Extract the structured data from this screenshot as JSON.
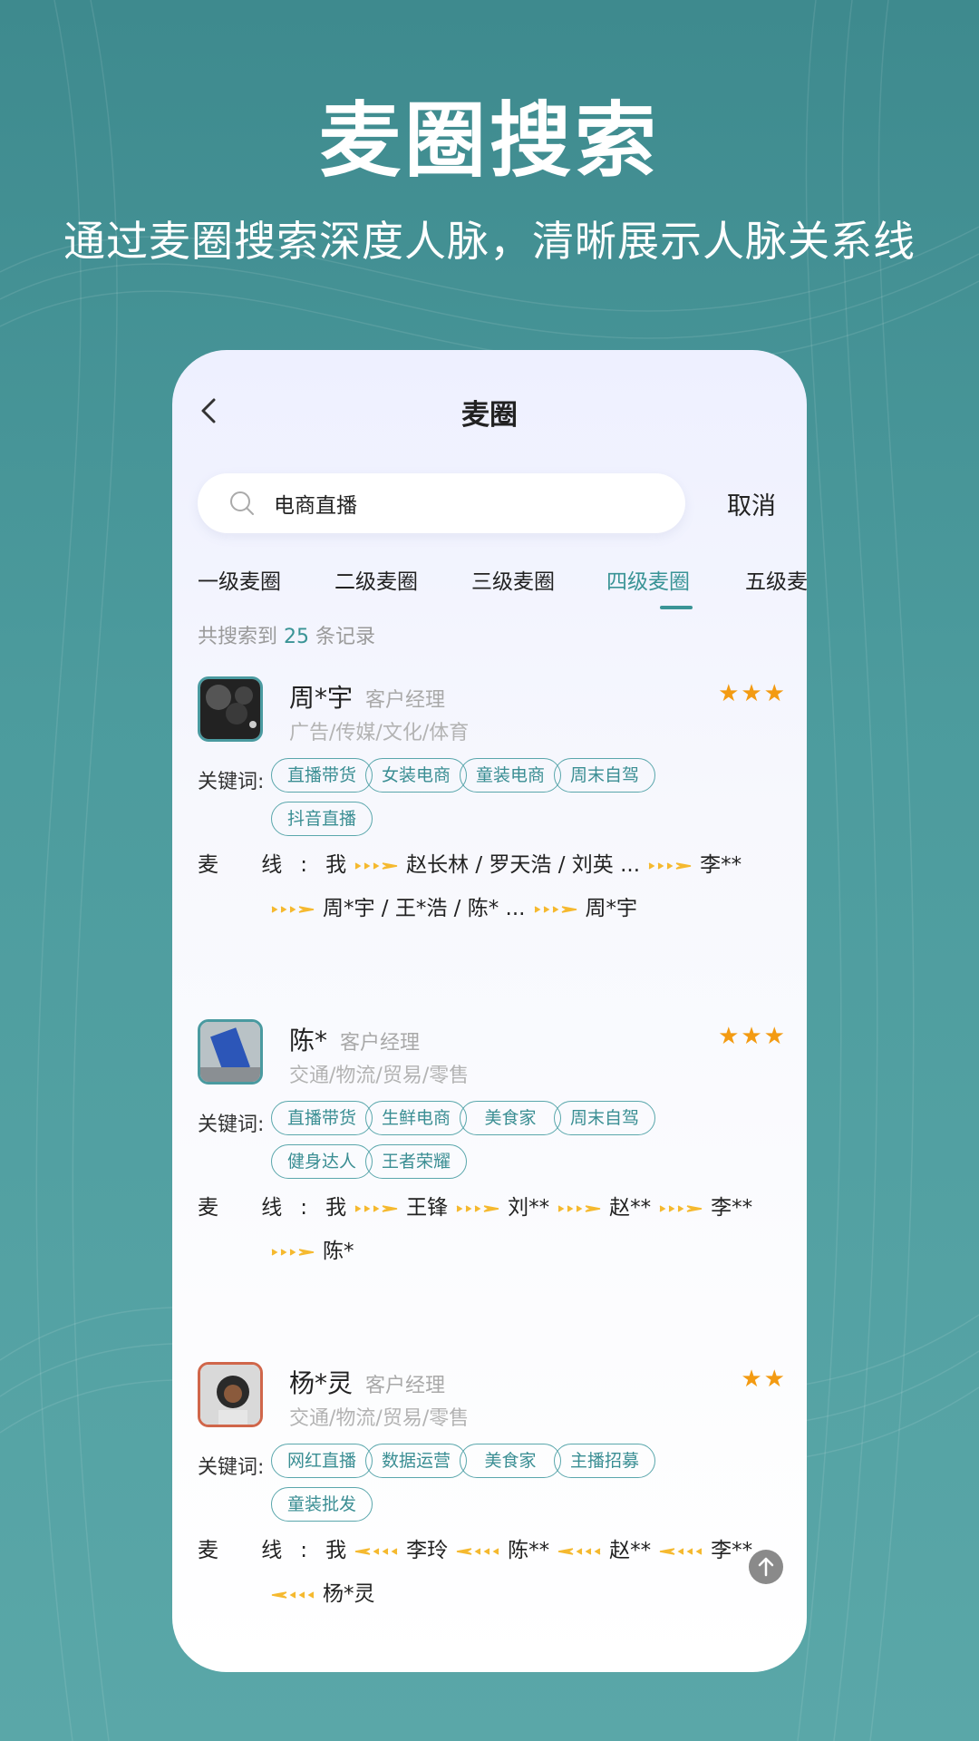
{
  "promo": {
    "headline": "麦圈搜索",
    "subline": "通过麦圈搜索深度人脉，清晰展示人脉关系线"
  },
  "app": {
    "title": "麦圈",
    "search": {
      "value": "电商直播",
      "cancel": "取消"
    },
    "tabs": [
      "一级麦圈",
      "二级麦圈",
      "三级麦圈",
      "四级麦圈",
      "五级麦"
    ],
    "active_tab": 3,
    "result": {
      "prefix": "共搜索到",
      "count": "25",
      "suffix": "条记录"
    },
    "labels": {
      "keywords": "关键词:",
      "line": "麦  线:"
    },
    "cards": [
      {
        "name": "周*宇",
        "role": "客户经理",
        "industry": "广告/传媒/文化/体育",
        "stars": "★★★",
        "tags": [
          "直播带货",
          "女装电商",
          "童装电商",
          "周末自驾",
          "抖音直播"
        ],
        "line1": [
          "我",
          "赵长林 / 罗天浩 / 刘英 ...",
          "李**"
        ],
        "line2": [
          "周*宇 / 王*浩 / 陈* ...",
          "周*宇"
        ]
      },
      {
        "name": "陈*",
        "role": "客户经理",
        "industry": "交通/物流/贸易/零售",
        "stars": "★★★",
        "tags": [
          "直播带货",
          "生鲜电商",
          "美食家",
          "周末自驾",
          "健身达人",
          "王者荣耀"
        ],
        "line1": [
          "我",
          "王锋",
          "刘**",
          "赵**",
          "李**"
        ],
        "line2": [
          "陈*"
        ]
      },
      {
        "name": "杨*灵",
        "role": "客户经理",
        "industry": "交通/物流/贸易/零售",
        "stars": "★★",
        "tags": [
          "网红直播",
          "数据运营",
          "美食家",
          "主播招募",
          "童装批发"
        ],
        "line1": [
          "我",
          "李玲",
          "陈**",
          "赵**",
          "李**"
        ],
        "line2": [
          "杨*灵"
        ]
      }
    ],
    "colors": {
      "accent": "#3a9496",
      "star": "#f39b12",
      "arrow": "#f5b92f"
    }
  }
}
